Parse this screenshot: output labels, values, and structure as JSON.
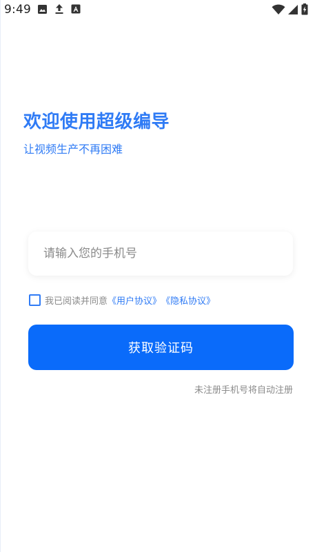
{
  "status_bar": {
    "time": "9:49",
    "left_icons": [
      "image-icon",
      "upload-icon",
      "font-a-icon"
    ],
    "right_icons": [
      "wifi-icon",
      "signal-icon",
      "battery-icon"
    ]
  },
  "header": {
    "title": "欢迎使用超级编导",
    "subtitle": "让视频生产不再困难"
  },
  "login": {
    "phone_placeholder": "请输入您的手机号",
    "phone_value": "",
    "agreement_prefix": "我已阅读并同意",
    "user_agreement": "《用户协议》",
    "privacy_policy": "《隐私协议》",
    "agreement_checked": false,
    "submit_label": "获取验证码",
    "auto_register_note": "未注册手机号将自动注册"
  },
  "colors": {
    "accent": "#2f7bf5",
    "button": "#0a6bfa",
    "muted_text": "#8a8a8a",
    "background": "#ffffff"
  }
}
